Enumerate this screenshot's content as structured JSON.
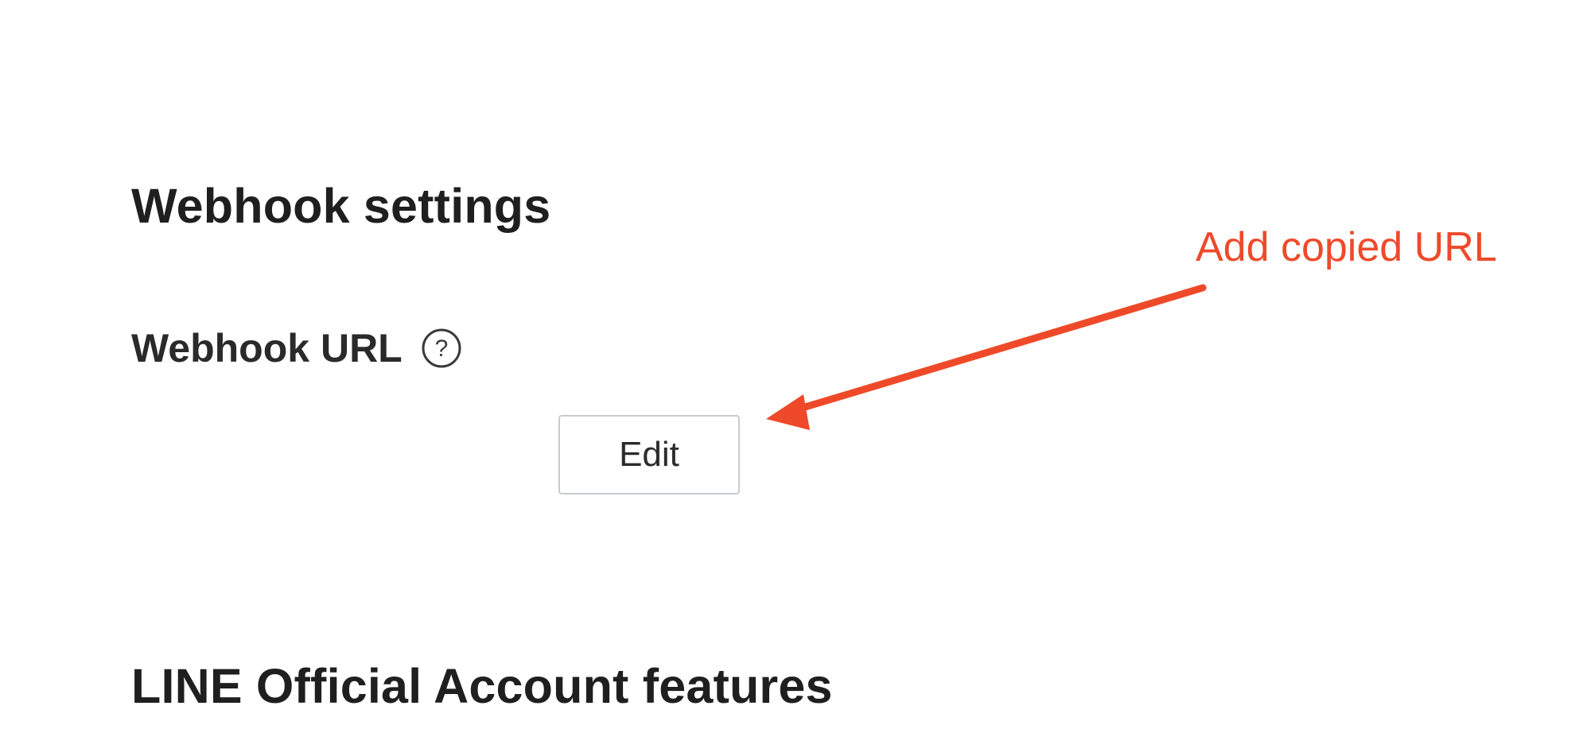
{
  "webhook_section": {
    "title": "Webhook settings",
    "url_label": "Webhook URL",
    "help_icon": "help-circle-icon",
    "edit_label": "Edit"
  },
  "features_section": {
    "title": "LINE Official Account features"
  },
  "annotation": {
    "text": "Add copied URL",
    "color": "#ee4a2a"
  },
  "colors": {
    "heading": "#1f1f1f",
    "button_border": "#c8cbd0",
    "icon": "#3a3a3a"
  }
}
